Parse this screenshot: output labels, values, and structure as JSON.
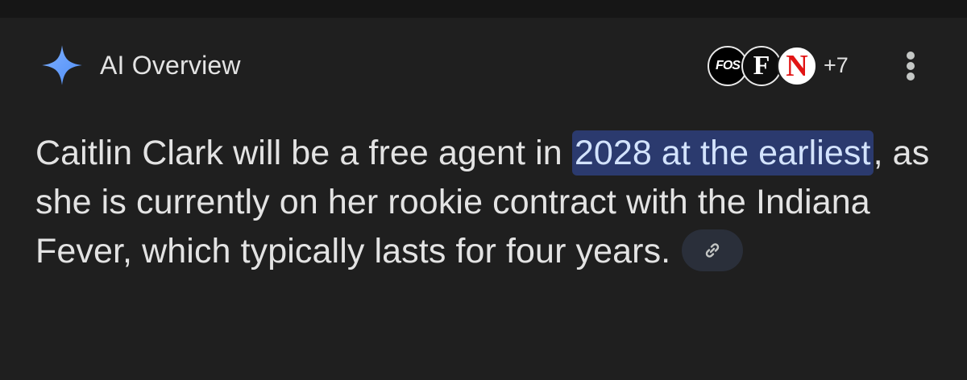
{
  "overview": {
    "title": "AI Overview",
    "more_sources_label": "+7"
  },
  "sources": [
    {
      "name": "FOS",
      "label": "FOS"
    },
    {
      "name": "F",
      "label": "F"
    },
    {
      "name": "N",
      "label": "N"
    }
  ],
  "answer": {
    "text_before": "Caitlin Clark will be a free agent in ",
    "highlight": "2028 at the earliest",
    "text_after": ", as she is currently on her rookie contract with the Indiana Fever, which typically lasts for four years."
  },
  "icons": {
    "sparkle": "sparkle-icon",
    "menu": "more-vert-icon",
    "link": "link-icon"
  },
  "colors": {
    "background": "#1f1f1f",
    "highlight_bg": "#2b3a6e",
    "highlight_text": "#d3e3fd",
    "sparkle": "#8ab4f8"
  }
}
